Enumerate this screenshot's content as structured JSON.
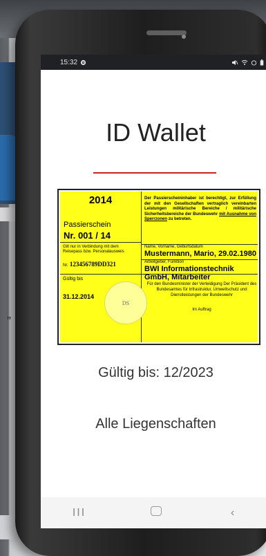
{
  "background": {
    "quote_fragment": "”"
  },
  "statusbar": {
    "time": "15:32",
    "left_icon": "settings-gear-icon",
    "right_icons": [
      "mute-icon",
      "wifi-icon",
      "alarm-icon",
      "battery-icon"
    ]
  },
  "app": {
    "title": "ID Wallet",
    "accent_color": "#cf1f1f",
    "validity_text": "Gültig bis: 12/2023",
    "locations_text": "Alle Liegenschaften"
  },
  "pass": {
    "year": "2014",
    "type": "Passierschein",
    "number": "Nr. 001 / 14",
    "validity_note": "Gilt nur in Verbindung mit dem Reisepass bzw. Personalausweis",
    "id_prefix": "Nr.",
    "id_number": "123456789DD321",
    "valid_until_label": "Gültig bis",
    "valid_until": "31.12.2014",
    "stamp_text": "DS",
    "legal_text_1": "Der Passierscheininhaber ist berechtigt, zur Erfüllung der mit den Gesellschaften vertraglich vereinbarten Leistungen militärische Bereiche / militärische Sicherheitsbereiche der Bundeswehr",
    "legal_text_underlined": "mit Ausnahme von Sperrzonen",
    "legal_text_2": "zu betreten.",
    "name_label": "Name, Vorname, Geburtsdatum",
    "name_value": "Mustermann, Mario, 29.02.1980",
    "employer_label": "Arbeitgeber, Funktion",
    "employer_value": "BWI Informationstechnik GmbH, Mitarbeiter",
    "authority_text": "Für den Bundesminister der Verteidigung Der Präsident des Bundesamtes für Infrastruktur, Umweltschutz und Dienstleistungen der Bundeswehr",
    "signature_text": "Im Auftrag",
    "background_color": "#ffff1a"
  },
  "navbar": {
    "recent_glyph": "III",
    "back_glyph": "‹"
  }
}
